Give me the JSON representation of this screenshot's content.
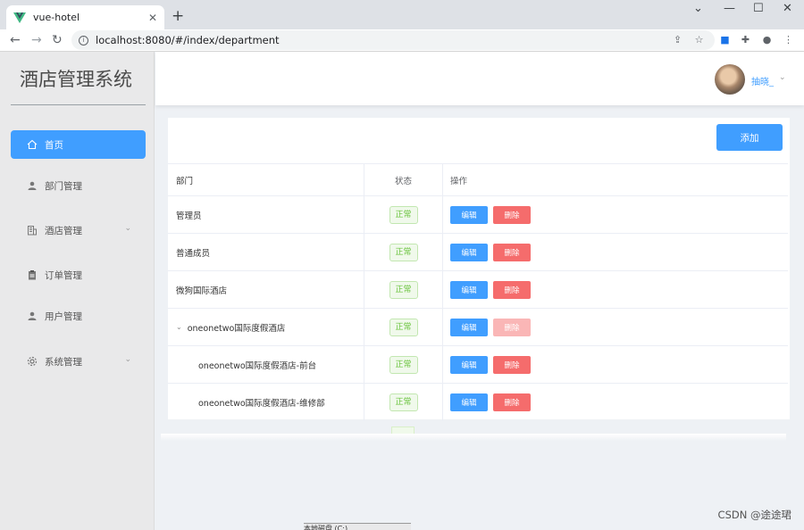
{
  "browser": {
    "tab_title": "vue-hotel",
    "tab_close": "✕",
    "new_tab": "+",
    "url": "localhost:8080/#/index/department",
    "window_controls": [
      "⌄",
      "—",
      "☐",
      "✕"
    ]
  },
  "sidebar": {
    "brand": "酒店管理系统",
    "items": [
      {
        "label": "首页",
        "icon": "home-icon",
        "active": true
      },
      {
        "label": "部门管理",
        "icon": "user-icon"
      },
      {
        "label": "酒店管理",
        "icon": "building-icon",
        "has_submenu": true
      },
      {
        "label": "订单管理",
        "icon": "clipboard-icon"
      },
      {
        "label": "用户管理",
        "icon": "user-icon"
      },
      {
        "label": "系统管理",
        "icon": "gear-icon",
        "has_submenu": true
      }
    ]
  },
  "header": {
    "username": "抽晓_"
  },
  "toolbar": {
    "add_label": "添加"
  },
  "table": {
    "columns": [
      "部门",
      "状态",
      "操作"
    ],
    "rows": [
      {
        "dept": "管理员",
        "status": "正常",
        "level": 0
      },
      {
        "dept": "普通成员",
        "status": "正常",
        "level": 0
      },
      {
        "dept": "微狗国际酒店",
        "status": "正常",
        "level": 0
      },
      {
        "dept": "oneonetwo国际度假酒店",
        "status": "正常",
        "level": 0,
        "expanded": true,
        "delete_disabled": true
      },
      {
        "dept": "oneonetwo国际度假酒店-前台",
        "status": "正常",
        "level": 1
      },
      {
        "dept": "oneonetwo国际度假酒店-维修部",
        "status": "正常",
        "level": 1
      }
    ],
    "edit_label": "编辑",
    "delete_label": "删除"
  },
  "watermark": "CSDN @途途珺",
  "taskbar_text": "本地磁盘 (C:)",
  "colors": {
    "primary": "#409eff",
    "danger": "#f56c6c",
    "success": "#67c23a"
  }
}
